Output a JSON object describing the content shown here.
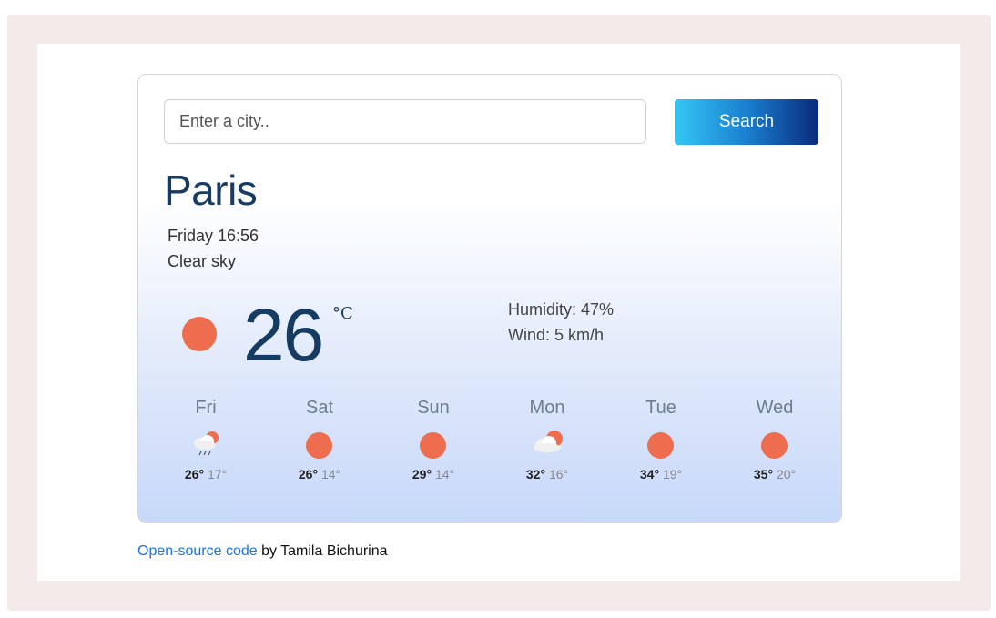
{
  "search": {
    "placeholder": "Enter a city..",
    "button_label": "Search"
  },
  "current": {
    "city": "Paris",
    "datetime": "Friday 16:56",
    "description": "Clear sky",
    "temperature": "26",
    "unit": "°C",
    "humidity": "Humidity: 47%",
    "wind": "Wind: 5 km/h",
    "icon": "sun-icon"
  },
  "forecast": [
    {
      "day": "Fri",
      "max": "26°",
      "min": "17°",
      "icon": "rain-cloud-icon"
    },
    {
      "day": "Sat",
      "max": "26°",
      "min": "14°",
      "icon": "sun-icon"
    },
    {
      "day": "Sun",
      "max": "29°",
      "min": "14°",
      "icon": "sun-icon"
    },
    {
      "day": "Mon",
      "max": "32°",
      "min": "16°",
      "icon": "partly-cloudy-icon"
    },
    {
      "day": "Tue",
      "max": "34°",
      "min": "19°",
      "icon": "sun-icon"
    },
    {
      "day": "Wed",
      "max": "35°",
      "min": "20°",
      "icon": "sun-icon"
    }
  ],
  "footer": {
    "link_text": "Open-source code",
    "text": " by Tamila Bichurina"
  },
  "colors": {
    "accent": "#163c64",
    "sun": "#ed6d4e",
    "link": "#1a73e8",
    "frame": "#f5eaea"
  }
}
